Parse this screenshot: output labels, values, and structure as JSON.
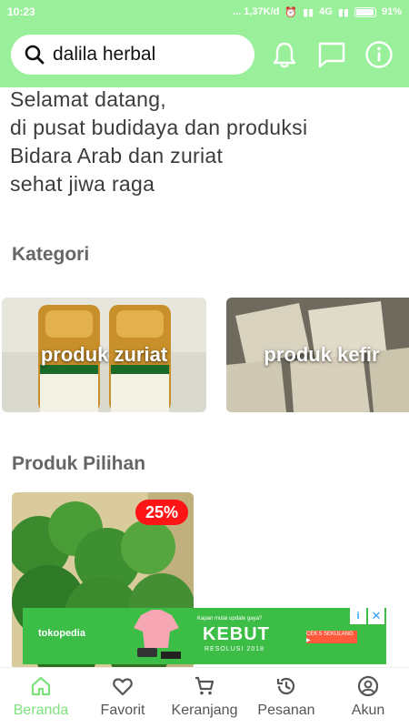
{
  "status_bar": {
    "time": "10:23",
    "speed": "... 1,37K/d",
    "network": "4G",
    "battery": "91%"
  },
  "search": {
    "query": "dalila herbal"
  },
  "welcome": {
    "lines": [
      "Selamat datang,",
      "di pusat budidaya dan produksi",
      "Bidara Arab dan zuriat",
      "sehat jiwa raga"
    ]
  },
  "categories": {
    "title": "Kategori",
    "items": [
      {
        "label": "produk zuriat"
      },
      {
        "label": "produk kefir"
      }
    ]
  },
  "featured": {
    "title": "Produk Pilihan",
    "items": [
      {
        "discount": "25%"
      }
    ]
  },
  "ad": {
    "brand": "tokopedia",
    "small_text": "Kapan mulai update gaya?",
    "headline": "KEBUT",
    "subline": "RESOLUSI 2018",
    "cta": "CEK 5 SEKULANG ▶"
  },
  "bottom_nav": {
    "items": [
      {
        "label": "Beranda",
        "icon": "home-icon"
      },
      {
        "label": "Favorit",
        "icon": "heart-icon"
      },
      {
        "label": "Keranjang",
        "icon": "cart-icon"
      },
      {
        "label": "Pesanan",
        "icon": "history-icon"
      },
      {
        "label": "Akun",
        "icon": "account-icon"
      }
    ]
  },
  "colors": {
    "brand_green": "#9af09a",
    "active_nav": "#7de27d",
    "discount_red": "#ff1515"
  }
}
